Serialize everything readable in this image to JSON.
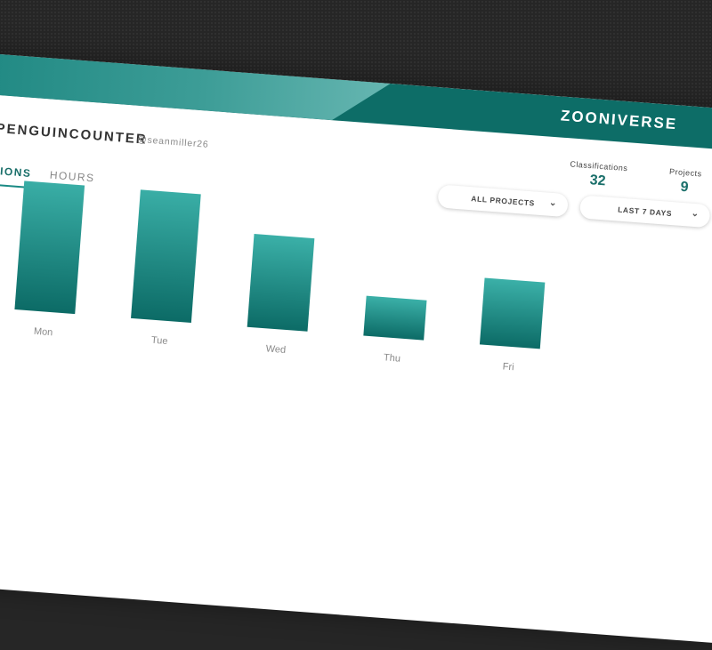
{
  "brand": {
    "logo": "ZOONIVERSE"
  },
  "profile": {
    "username": "PENGUINCOUNTER",
    "handle": "@seanmiller26"
  },
  "stats": [
    {
      "label": "Classifications",
      "value": "32"
    },
    {
      "label": "Projects",
      "value": "9"
    }
  ],
  "tabs": [
    {
      "label": "ATIONS",
      "active": true
    },
    {
      "label": "HOURS",
      "active": false
    }
  ],
  "filters": {
    "project": "ALL PROJECTS",
    "range": "LAST 7 DAYS"
  },
  "colors": {
    "accent": "#0d6d67",
    "bar_top": "#3bb0a8",
    "bar_bottom": "#0c6b66"
  },
  "icons": {
    "dropdown": "chevron-down-icon"
  },
  "chart_data": {
    "type": "bar",
    "categories": [
      "Mon",
      "Tue",
      "Wed",
      "Thu",
      "Fri"
    ],
    "values": [
      10,
      10,
      7,
      3,
      5
    ],
    "ylim": [
      0,
      10
    ],
    "grid": false,
    "xlabel": "",
    "ylabel": ""
  }
}
